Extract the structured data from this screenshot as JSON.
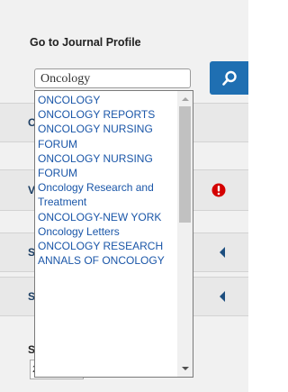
{
  "panel": {
    "heading": "Go to Journal Profile",
    "search_value": "Oncology",
    "search_button_icon": "search-icon"
  },
  "sections": [
    {
      "letter": "O"
    },
    {
      "letter": "V",
      "icon": "alert-icon"
    },
    {
      "letter": "S",
      "icon": "caret-left-icon"
    },
    {
      "letter": "S",
      "icon": "caret-left-icon"
    }
  ],
  "bottom": {
    "label": "S",
    "select_value": "2"
  },
  "dropdown": {
    "items": [
      "ONCOLOGY",
      "ONCOLOGY REPORTS",
      "ONCOLOGY NURSING FORUM",
      "ONCOLOGY NURSING FORUM",
      "Oncology Research and Treatment",
      "ONCOLOGY-NEW YORK",
      "Oncology Letters",
      "ONCOLOGY RESEARCH",
      "ANNALS OF ONCOLOGY"
    ]
  },
  "colors": {
    "accent_blue": "#1f6fb2",
    "link_blue": "#1a56a8",
    "alert_red": "#d40000"
  }
}
